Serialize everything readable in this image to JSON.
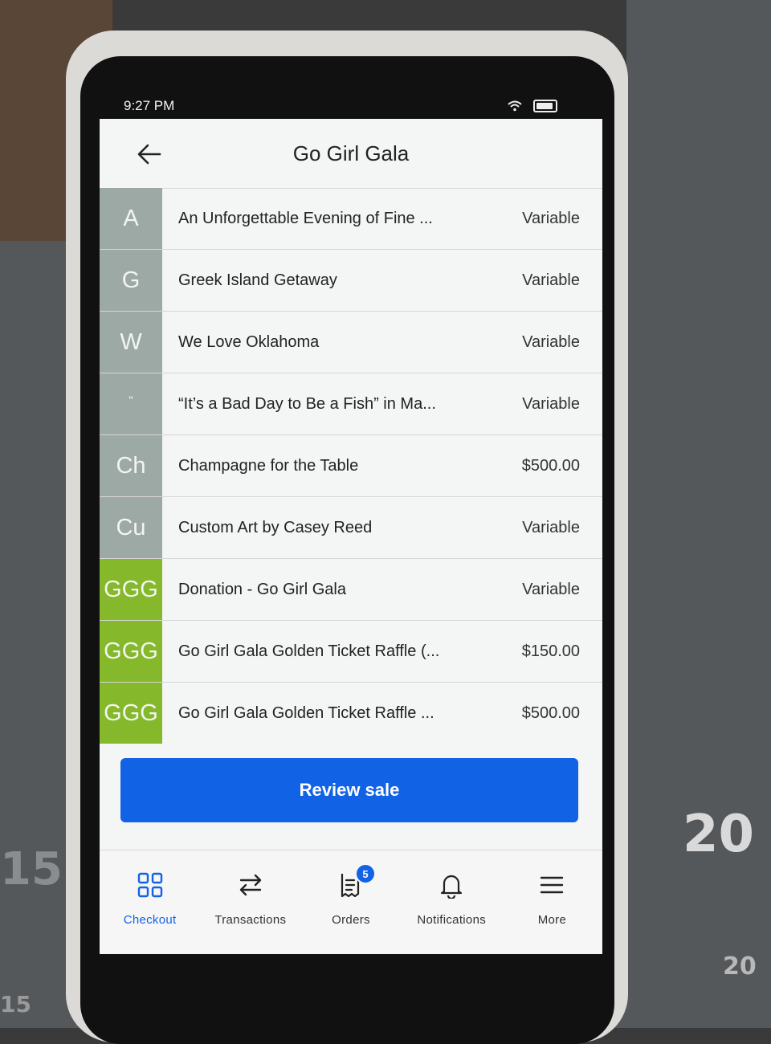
{
  "status_bar": {
    "time": "9:27 PM"
  },
  "header": {
    "title": "Go Girl Gala"
  },
  "items": [
    {
      "tile": "A",
      "tile_color": "#9da9a5",
      "name": "An Unforgettable Evening of Fine ...",
      "price": "Variable"
    },
    {
      "tile": "G",
      "tile_color": "#9da9a5",
      "name": "Greek Island Getaway",
      "price": "Variable"
    },
    {
      "tile": "W",
      "tile_color": "#9da9a5",
      "name": "We Love Oklahoma",
      "price": "Variable"
    },
    {
      "tile": "“",
      "tile_color": "#9da9a5",
      "name": "“It’s a Bad Day to Be a Fish” in Ma...",
      "price": "Variable"
    },
    {
      "tile": "Ch",
      "tile_color": "#9da9a5",
      "name": "Champagne for the Table",
      "price": "$500.00"
    },
    {
      "tile": "Cu",
      "tile_color": "#9da9a5",
      "name": "Custom Art by Casey Reed",
      "price": "Variable"
    },
    {
      "tile": "GGG",
      "tile_color": "#86b82b",
      "name": "Donation - Go Girl Gala",
      "price": "Variable"
    },
    {
      "tile": "GGG",
      "tile_color": "#86b82b",
      "name": "Go Girl Gala Golden Ticket Raffle (...",
      "price": "$150.00"
    },
    {
      "tile": "GGG",
      "tile_color": "#86b82b",
      "name": "Go Girl Gala Golden Ticket Raffle ...",
      "price": "$500.00"
    }
  ],
  "review_button": {
    "label": "Review sale",
    "color": "#1262e6"
  },
  "tabs": [
    {
      "label": "Checkout",
      "icon": "grid-icon",
      "active": true
    },
    {
      "label": "Transactions",
      "icon": "swap-arrows-icon",
      "active": false
    },
    {
      "label": "Orders",
      "icon": "receipt-icon",
      "badge": "5",
      "active": false
    },
    {
      "label": "Notifications",
      "icon": "bell-icon",
      "active": false
    },
    {
      "label": "More",
      "icon": "menu-icon",
      "active": false
    }
  ],
  "environment": {
    "ruler_numbers": [
      "15",
      "20",
      "20",
      "15"
    ]
  }
}
